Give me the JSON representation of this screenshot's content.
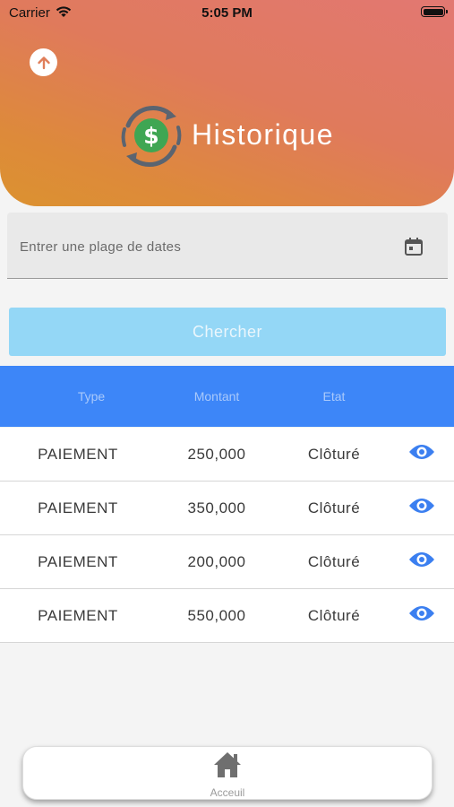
{
  "status_bar": {
    "carrier": "Carrier",
    "time": "5:05 PM"
  },
  "header": {
    "title": "Historique",
    "back_icon": "arrow-up-icon",
    "logo_icon": "dollar-exchange-icon"
  },
  "search": {
    "date_placeholder": "Entrer une plage de dates",
    "calendar_icon": "calendar-icon",
    "button_label": "Chercher"
  },
  "table": {
    "columns": [
      "Type",
      "Montant",
      "Etat"
    ],
    "rows": [
      {
        "type": "PAIEMENT",
        "montant": "250,000",
        "etat": "Clôturé"
      },
      {
        "type": "PAIEMENT",
        "montant": "350,000",
        "etat": "Clôturé"
      },
      {
        "type": "PAIEMENT",
        "montant": "200,000",
        "etat": "Clôturé"
      },
      {
        "type": "PAIEMENT",
        "montant": "550,000",
        "etat": "Clôturé"
      }
    ],
    "row_action_icon": "eye-icon"
  },
  "bottom_nav": {
    "label": "Acceuil",
    "icon": "home-icon"
  },
  "colors": {
    "header_start": "#e27872",
    "header_end": "#dc9230",
    "table_header": "#3d86f8",
    "button": "#94d7f6",
    "eye": "#3b7ff0",
    "logo_green": "#3fa653"
  }
}
